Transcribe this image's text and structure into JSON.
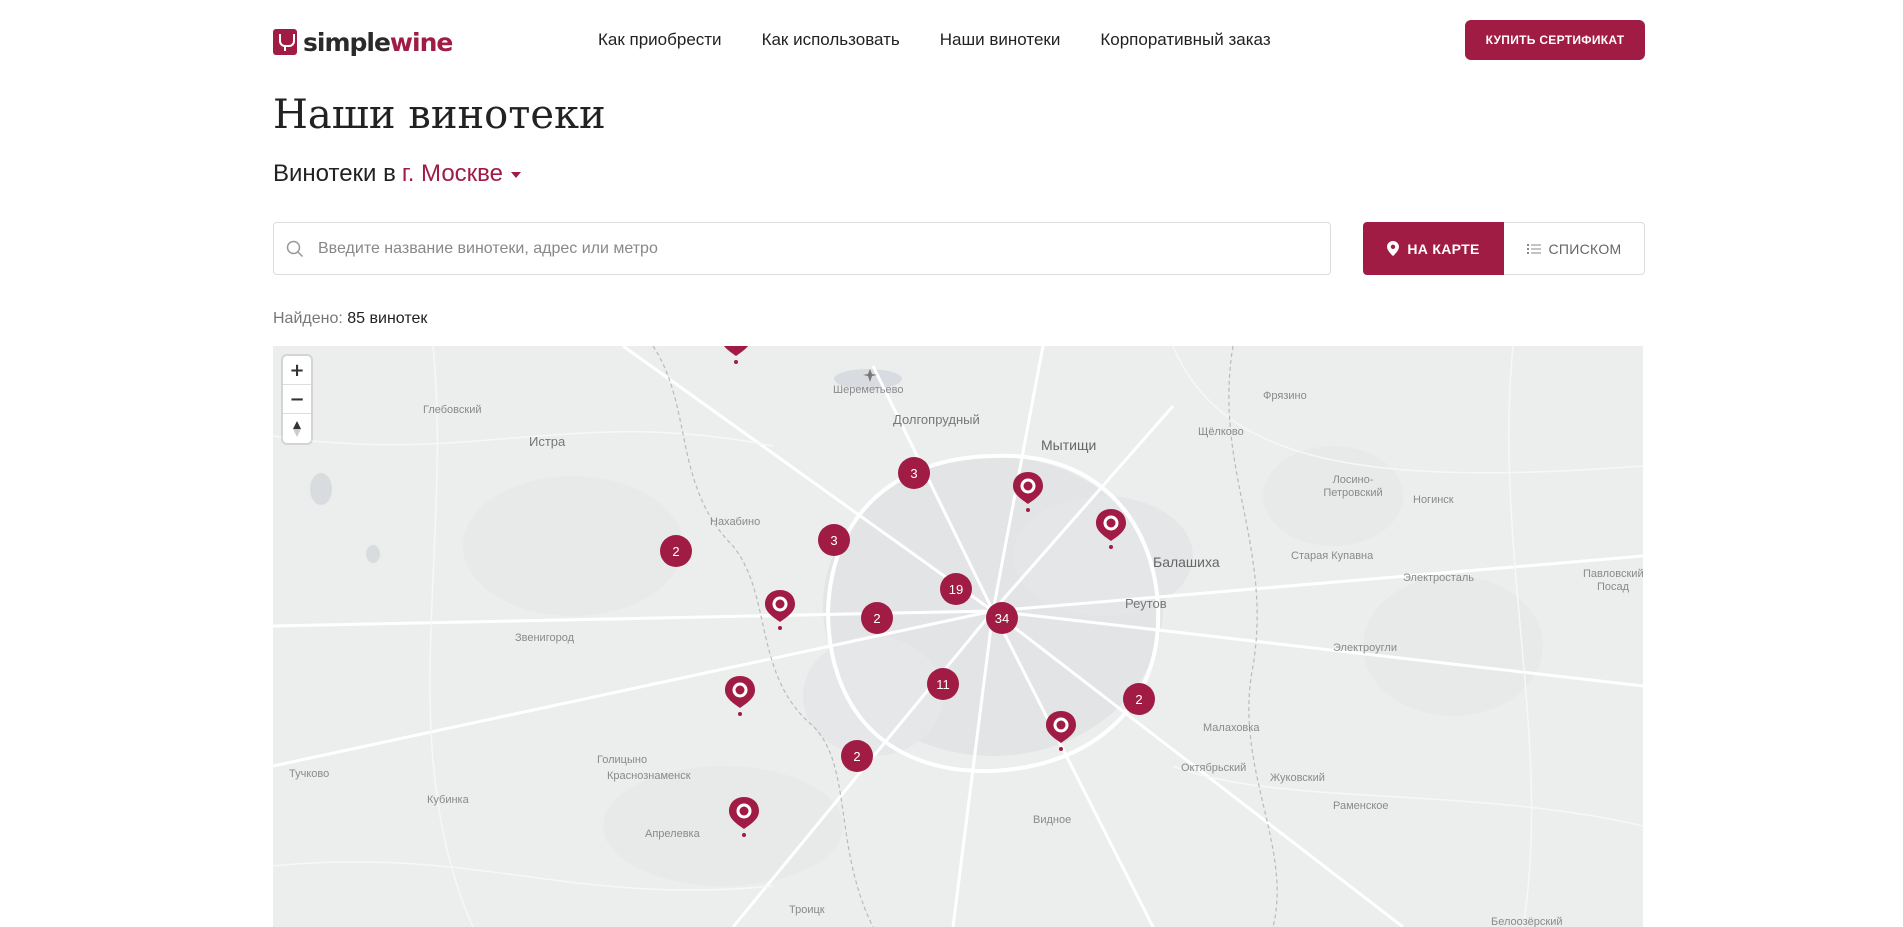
{
  "header": {
    "logo_simple": "simple",
    "logo_wine": "wine",
    "nav": [
      {
        "label": "Как приобрести"
      },
      {
        "label": "Как использовать"
      },
      {
        "label": "Наши винотеки"
      },
      {
        "label": "Корпоративный заказ"
      }
    ],
    "buy_button": "КУПИТЬ СЕРТИФИКАТ"
  },
  "main": {
    "title": "Наши винотеки",
    "city_prefix": "Винотеки в",
    "city": "г. Москве",
    "search_placeholder": "Введите название винотеки, адрес или метро",
    "view_map": "НА КАРТЕ",
    "view_list": "СПИСКОМ",
    "found_label": "Найдено:",
    "found_value": "85 винотек"
  },
  "map": {
    "zoom_in": "+",
    "zoom_out": "−",
    "places": [
      "Шереметьево",
      "Глебовский",
      "Истра",
      "Долгопрудный",
      "Мытищи",
      "Фрязино",
      "Щёлково",
      "Лосино-Петровский",
      "Ногинск",
      "Нахабино",
      "Балашиха",
      "Старая Купавна",
      "Электросталь",
      "Павловский Посад",
      "Реутов",
      "Звенигород",
      "Электроугли",
      "Малаховка",
      "Октябрьский",
      "Жуковский",
      "Тучково",
      "Голицыно",
      "Краснознаменск",
      "Кубинка",
      "Раменское",
      "Видное",
      "Апрелевка",
      "Троицк",
      "Белоозёрский"
    ],
    "clusters": [
      "3",
      "3",
      "2",
      "19",
      "2",
      "34",
      "11",
      "2",
      "2"
    ],
    "colors": {
      "accent": "#a01c45",
      "map_bg": "#eceded"
    }
  }
}
